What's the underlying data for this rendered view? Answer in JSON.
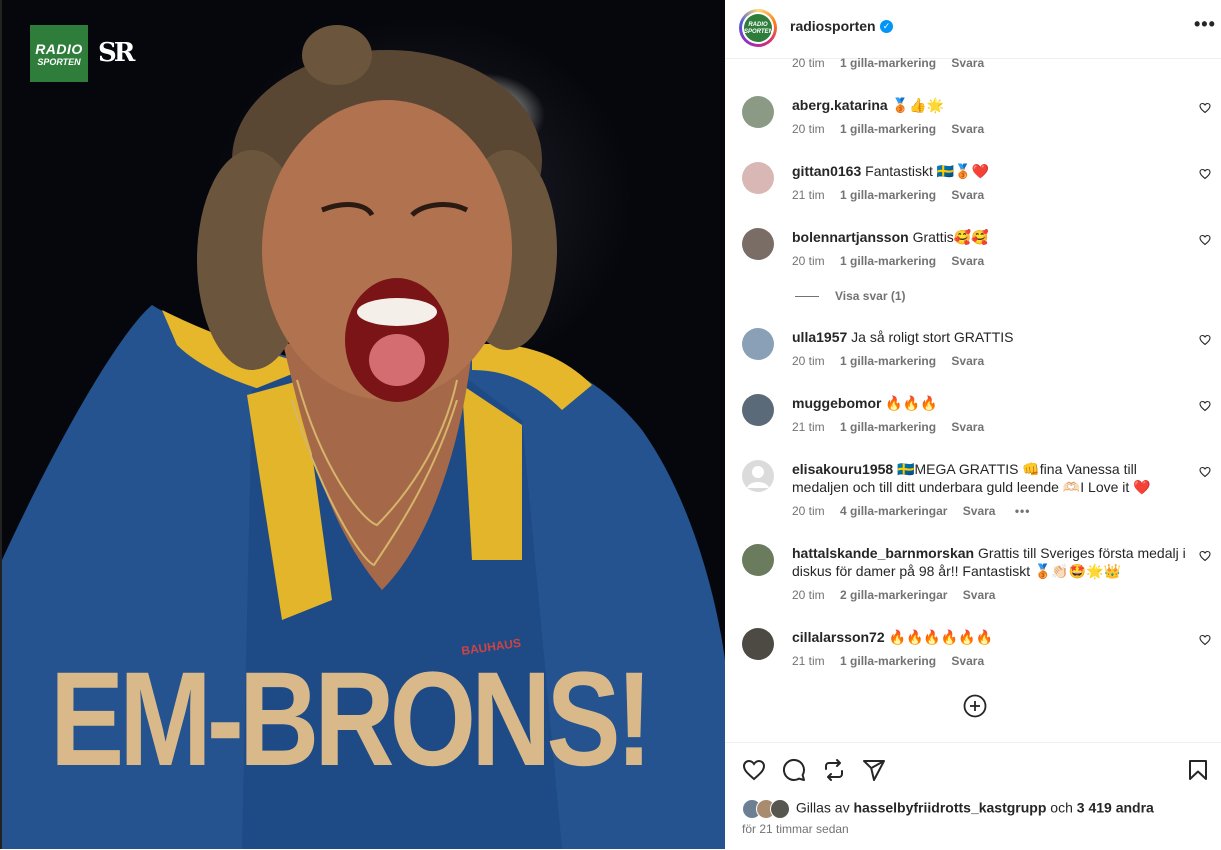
{
  "post": {
    "brand_line1": "RADIO",
    "brand_line2": "SPORTEN",
    "sr_logo": "SR",
    "headline": "EM-BRONS!",
    "shirt_text": "BAUHAUS"
  },
  "header": {
    "avatar_line1": "RADIO",
    "avatar_line2": "SPORTEN",
    "username": "radiosporten",
    "verified_icon": "verified-badge-icon",
    "more_icon": "•••"
  },
  "top_meta": {
    "time": "20 tim",
    "likes": "1 gilla-markering",
    "reply": "Svara"
  },
  "comments": [
    {
      "user": "aberg.katarina",
      "text": "🥉👍🌟",
      "time": "20 tim",
      "likes": "1 gilla-markering",
      "reply": "Svara",
      "avatar_color": "#8a9a84"
    },
    {
      "user": "gittan0163",
      "text": "Fantastiskt 🇸🇪🥉❤️",
      "time": "21 tim",
      "likes": "1 gilla-markering",
      "reply": "Svara",
      "avatar_color": "#d9b7b4"
    },
    {
      "user": "bolennartjansson",
      "text": "Grattis🥰🥰",
      "time": "20 tim",
      "likes": "1 gilla-markering",
      "reply": "Svara",
      "avatar_color": "#7a6d66"
    },
    {
      "user": "ulla1957",
      "text": "Ja så roligt stort GRATTIS",
      "time": "20 tim",
      "likes": "1 gilla-markering",
      "reply": "Svara",
      "avatar_color": "#8aa0b6"
    },
    {
      "user": "muggebomor",
      "text": "🔥🔥🔥",
      "time": "21 tim",
      "likes": "1 gilla-markering",
      "reply": "Svara",
      "avatar_color": "#5a6a78"
    },
    {
      "user": "elisakouru1958",
      "text": "🇸🇪MEGA GRATTIS 👊fina Vanessa till medaljen och till ditt underbara guld leende 🫶🏻I Love it ❤️",
      "time": "20 tim",
      "likes": "4 gilla-markeringar",
      "reply": "Svara",
      "more": "•••",
      "avatar_color": "#dbdbdb"
    },
    {
      "user": "hattalskande_barnmorskan",
      "text": "Grattis till Sveriges första medalj i diskus för damer på 98 år!! Fantastiskt 🥉👏🏻🤩🌟👑",
      "time": "20 tim",
      "likes": "2 gilla-markeringar",
      "reply": "Svara",
      "avatar_color": "#6b7b5e"
    },
    {
      "user": "cillalarsson72",
      "text": "🔥🔥🔥🔥🔥🔥",
      "time": "21 tim",
      "likes": "1 gilla-markering",
      "reply": "Svara",
      "avatar_color": "#4d4a44"
    }
  ],
  "view_replies": "Visa svar (1)",
  "footer": {
    "liked_by_prefix": "Gillas av",
    "liked_by_user": "hasselbyfriidrotts_kastgrupp",
    "liked_by_mid": "och",
    "liked_by_count": "3 419 andra",
    "time_ago": "för 21 timmar sedan"
  },
  "icons": [
    "heart-icon",
    "comment-icon",
    "repost-icon",
    "share-icon",
    "bookmark-icon",
    "add-comment-icon"
  ]
}
